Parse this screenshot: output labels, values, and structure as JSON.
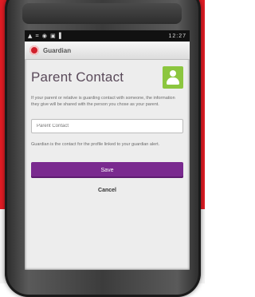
{
  "colors": {
    "brand_red": "#e11c24",
    "accent_purple": "#7a2a8f",
    "contact_green": "#8cc63f"
  },
  "status": {
    "signal_icons": "▲ ⌗ ◉ ▣ ▌",
    "time": "12:27"
  },
  "app": {
    "name": "Guardian"
  },
  "page": {
    "title": "Parent Contact",
    "icon": "person-contact-icon",
    "description": "If your parent or relative is guarding contact with someone, the information they give will be shared with the person you chose as your parent.",
    "input_placeholder": "Parent Contact",
    "note": "Guardian is the contact for the profile linked to your guardian alert.",
    "primary_button": "Save",
    "secondary_button": "Cancel"
  }
}
